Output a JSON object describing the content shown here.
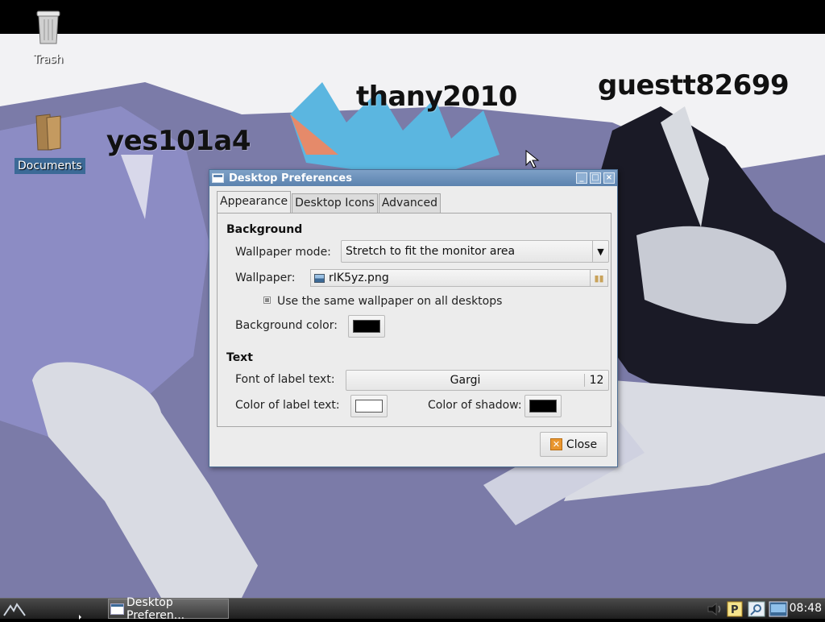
{
  "desktop": {
    "icons": [
      {
        "label": "Trash",
        "icon": "trash-icon"
      },
      {
        "label": "Documents",
        "icon": "folder-icon"
      }
    ],
    "wallpaper_text": [
      "yes101a4",
      "thany2010",
      "guestt82699"
    ]
  },
  "dialog": {
    "title": "Desktop Preferences",
    "tabs": [
      {
        "label": "Appearance",
        "active": true
      },
      {
        "label": "Desktop Icons",
        "active": false
      },
      {
        "label": "Advanced",
        "active": false
      }
    ],
    "background": {
      "heading": "Background",
      "wallpaper_mode_label": "Wallpaper mode:",
      "wallpaper_mode_value": "Stretch to fit the monitor area",
      "wallpaper_label": "Wallpaper:",
      "wallpaper_file": "rIK5yz.png",
      "same_wallpaper_label": "Use the same wallpaper on all desktops",
      "same_wallpaper_checked": true,
      "bg_color_label": "Background color:",
      "bg_color": "#000000"
    },
    "text": {
      "heading": "Text",
      "font_label": "Font of label text:",
      "font_name": "Gargi",
      "font_size": "12",
      "label_color_label": "Color of label text:",
      "label_color": "#ffffff",
      "shadow_label": "Color of shadow:",
      "shadow_color": "#000000"
    },
    "close_label": "Close"
  },
  "taskbar": {
    "task_label": "Desktop Preferen...",
    "clock": "08:48",
    "tray_icons": [
      "volume-icon",
      "p-indicator-icon",
      "search-icon",
      "desktop-icon"
    ]
  },
  "colors": {
    "wallpaper_bg": "#7b7ba8",
    "titlebar": "#5b82ae",
    "selection": "#3c6a97"
  }
}
